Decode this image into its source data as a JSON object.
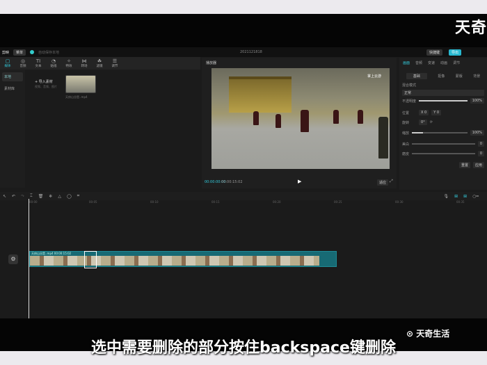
{
  "brand_logo": "天奇",
  "app": {
    "name": "剪映",
    "menu": "菜单",
    "project_status": "自动保存本地",
    "project_title": "2021121818",
    "shortcut_btn": "快捷键",
    "export_btn": "导出"
  },
  "tools": [
    {
      "label": "媒体",
      "icon": "▢"
    },
    {
      "label": "音频",
      "icon": "◎"
    },
    {
      "label": "文本",
      "icon": "TI"
    },
    {
      "label": "贴纸",
      "icon": "◔"
    },
    {
      "label": "特效",
      "icon": "✧"
    },
    {
      "label": "转场",
      "icon": "⋈"
    },
    {
      "label": "滤镜",
      "icon": "☘"
    },
    {
      "label": "调节",
      "icon": "☰"
    }
  ],
  "media": {
    "side": [
      "本地",
      "素材库"
    ],
    "import": "导入素材",
    "import_hint": "视频、音频、图片",
    "clip_name": "天府山谷是..mp4"
  },
  "player": {
    "title": "播放器",
    "current": "00:00:00:00",
    "total": "00:00:15:02",
    "ratio": "适应",
    "overlay": "掌上云游"
  },
  "props": {
    "tabs": [
      "画面",
      "音频",
      "变速",
      "动画",
      "调节"
    ],
    "subtabs": [
      "基础",
      "抠像",
      "蒙版",
      "背景"
    ],
    "blend_label": "混合模式",
    "blend_value": "正常",
    "opacity_label": "不透明度",
    "opacity_value": "100%",
    "position_label": "位置",
    "pos_x": "0",
    "pos_y": "0",
    "rotate_label": "旋转",
    "rotate_value": "0°",
    "scale_label": "缩放",
    "scale_value": "100%",
    "h_label": "美白",
    "h_value": "0",
    "v_label": "磨皮",
    "v_value": "0",
    "reset": "重置",
    "apply": "应用"
  },
  "timeline": {
    "ticks": [
      "00:00",
      "00:05",
      "00:10",
      "00:15",
      "00:20",
      "00:25",
      "00:30",
      "00:35",
      "00:40"
    ],
    "clip_label": "天府山谷是..mp4  00:00:15:02"
  },
  "subtitle": "选中需要删除的部分按住backspace键删除",
  "watermark": "天奇生活"
}
